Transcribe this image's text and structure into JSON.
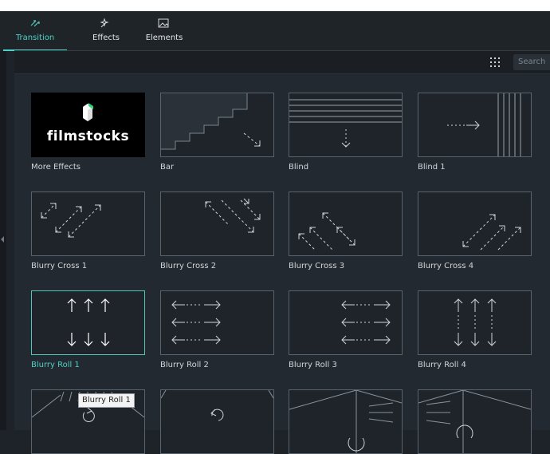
{
  "tabs": [
    {
      "label": "Transition",
      "icon": "transition-icon",
      "active": true
    },
    {
      "label": "Effects",
      "icon": "effects-icon",
      "active": false
    },
    {
      "label": "Elements",
      "icon": "elements-icon",
      "active": false
    }
  ],
  "search": {
    "placeholder": "Search"
  },
  "brand": {
    "accent": "#4fd1c5",
    "filmstocks_green": "#2bd67b"
  },
  "items": [
    {
      "label": "More Effects",
      "thumb": "filmstocks",
      "logo_text": "filmstocks"
    },
    {
      "label": "Bar",
      "thumb": "bar"
    },
    {
      "label": "Blind",
      "thumb": "blind"
    },
    {
      "label": "Blind 1",
      "thumb": "blind1"
    },
    {
      "label": "Blurry Cross 1",
      "thumb": "cross1"
    },
    {
      "label": "Blurry Cross 2",
      "thumb": "cross2"
    },
    {
      "label": "Blurry Cross 3",
      "thumb": "cross3"
    },
    {
      "label": "Blurry Cross 4",
      "thumb": "cross4"
    },
    {
      "label": "Blurry Roll 1",
      "thumb": "roll1",
      "selected": true
    },
    {
      "label": "Blurry Roll 2",
      "thumb": "roll2"
    },
    {
      "label": "Blurry Roll 3",
      "thumb": "roll3"
    },
    {
      "label": "Blurry Roll 4",
      "thumb": "roll4"
    },
    {
      "label": "",
      "thumb": "partial-a"
    },
    {
      "label": "",
      "thumb": "partial-b"
    },
    {
      "label": "",
      "thumb": "partial-c"
    },
    {
      "label": "",
      "thumb": "partial-d"
    }
  ],
  "tooltip": "Blurry Roll 1"
}
